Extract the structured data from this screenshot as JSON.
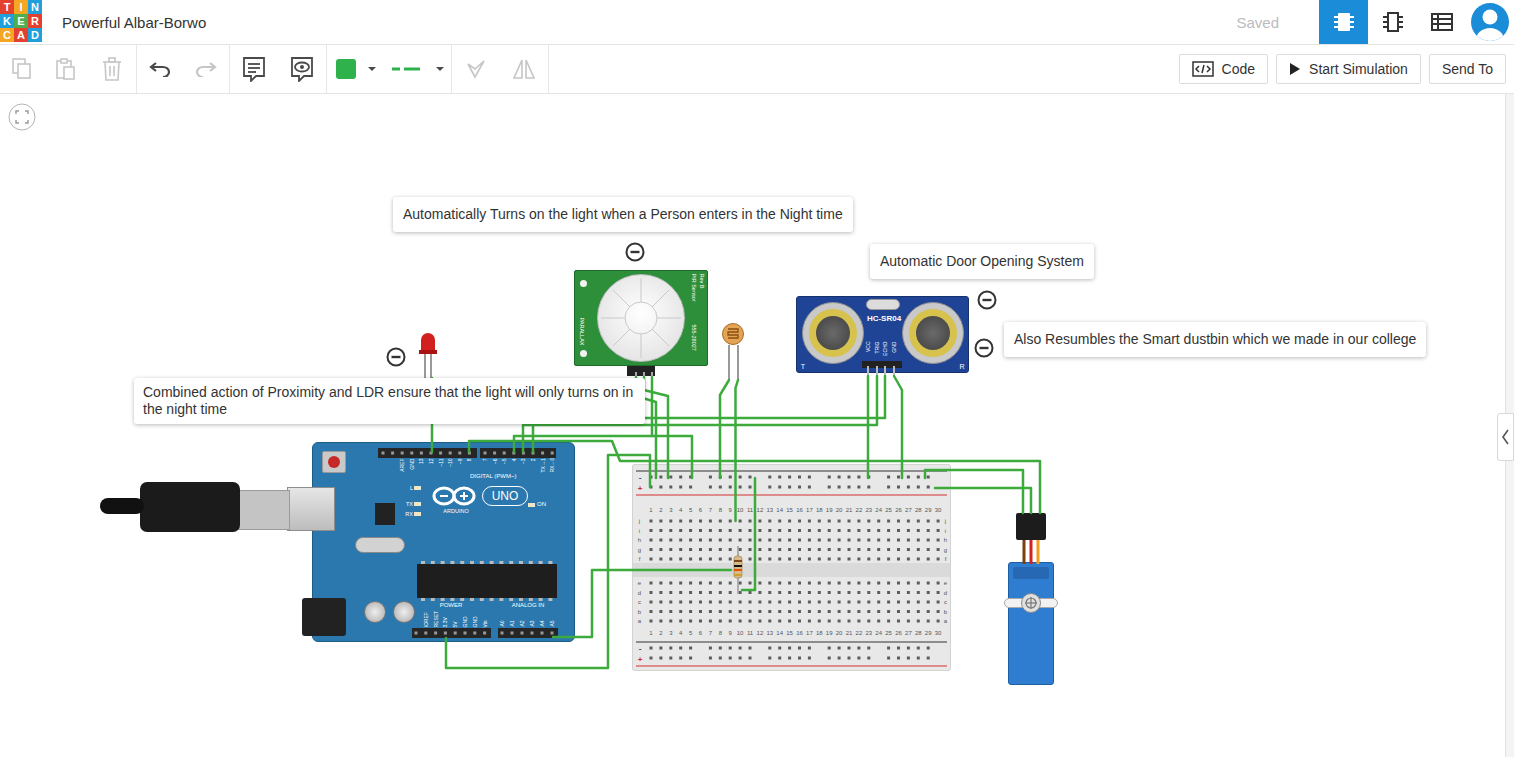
{
  "logo": {
    "letters": [
      "T",
      "I",
      "N",
      "K",
      "E",
      "R",
      "C",
      "A",
      "D"
    ]
  },
  "title": "Powerful Albar-Borwo",
  "status": "Saved",
  "views": [
    {
      "selected": true
    },
    {
      "selected": false
    },
    {
      "selected": false
    }
  ],
  "toolbar": {
    "tools": [
      {
        "disabled": true
      },
      {
        "disabled": true
      },
      {
        "disabled": true
      },
      {
        "disabled": false
      },
      {
        "disabled": true
      },
      {
        "disabled": false
      },
      {
        "disabled": false
      },
      {
        "disabled": false
      },
      {
        "disabled": false
      },
      {
        "disabled": true
      },
      {
        "disabled": true
      }
    ]
  },
  "actions": [
    {
      "label": "Code"
    },
    {
      "label": "Start Simulation"
    },
    {
      "label": "Send To"
    }
  ],
  "notes": [
    {
      "text": "Automatically Turns on the light when a Person enters in the Night time"
    },
    {
      "text": "Automatic Door Opening System"
    },
    {
      "text": "Also Resumbles the Smart dustbin which we made in our college"
    },
    {
      "text": "Combined action of Proximity and LDR ensure that the light will only turns on in the night time"
    }
  ],
  "arduino": {
    "brand": "ARDUINO",
    "model": "UNO",
    "digital_label": "DIGITAL (PWM~)",
    "power_label": "POWER",
    "analog_label": "ANALOG IN",
    "on_label": "ON",
    "leds": [
      "L",
      "TX",
      "RX"
    ],
    "digital_pins": [
      "AREF",
      "GND",
      "13",
      "12",
      "~11",
      "~10",
      "~9",
      "8",
      "7",
      "~6",
      "~5",
      "4",
      "~3",
      "2",
      "TX→1",
      "RX←0"
    ],
    "power_pins": [
      "IOREF",
      "RESET",
      "3.3V",
      "5V",
      "GND",
      "GND",
      "Vin"
    ],
    "analog_pins": [
      "A0",
      "A1",
      "A2",
      "A3",
      "A4",
      "A5"
    ]
  },
  "pir": {
    "name": "PIR Sensor",
    "revision": "Rev B",
    "maker": "PARALLAX",
    "part": "555-28027"
  },
  "sonar": {
    "model": "HC-SR04",
    "pins": [
      "VCC",
      "TRIG",
      "ECHO",
      "GND"
    ],
    "sides": [
      "T",
      "R"
    ]
  },
  "breadboard": {
    "columns": [
      "1",
      "2",
      "3",
      "4",
      "5",
      "6",
      "7",
      "8",
      "9",
      "10",
      "11",
      "12",
      "13",
      "14",
      "15",
      "16",
      "17",
      "18",
      "19",
      "20",
      "21",
      "22",
      "23",
      "24",
      "25",
      "26",
      "27",
      "28",
      "29",
      "30"
    ],
    "rows_top": [
      "j",
      "i",
      "h",
      "g",
      "f"
    ],
    "rows_bottom": [
      "e",
      "d",
      "c",
      "b",
      "a"
    ],
    "rails": [
      "-",
      "+"
    ]
  }
}
